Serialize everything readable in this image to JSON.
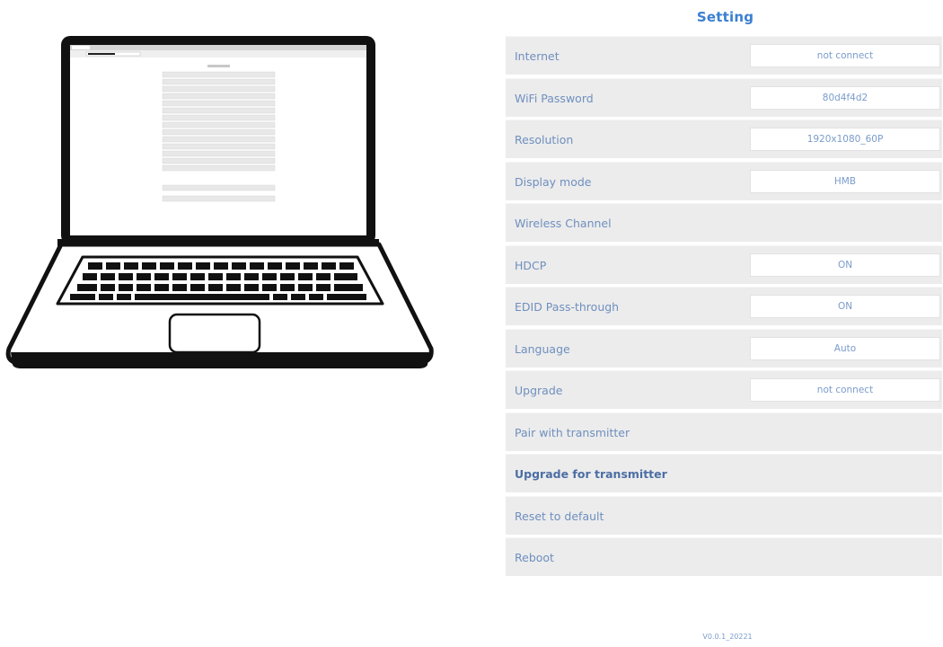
{
  "settings": {
    "title": "Setting",
    "rows": [
      {
        "label": "Internet",
        "value": "not connect"
      },
      {
        "label": "WiFi Password",
        "value": "80d4f4d2"
      },
      {
        "label": "Resolution",
        "value": "1920x1080_60P"
      },
      {
        "label": "Display mode",
        "value": "HMB"
      },
      {
        "label": "Wireless Channel",
        "value": null
      },
      {
        "label": "HDCP",
        "value": "ON"
      },
      {
        "label": "EDID Pass-through",
        "value": "ON"
      },
      {
        "label": "Language",
        "value": "Auto"
      },
      {
        "label": "Upgrade",
        "value": "not connect"
      },
      {
        "label": "Pair with transmitter",
        "value": null
      },
      {
        "label": "Upgrade for transmitter",
        "value": null
      },
      {
        "label": "Reset to default",
        "value": null
      },
      {
        "label": "Reboot",
        "value": null
      }
    ]
  },
  "footer": {
    "version": "V0.0.1_20221"
  },
  "icons": {
    "laptop": "laptop-icon"
  },
  "colors": {
    "accent": "#3a7fd1",
    "row_bg": "#ececec",
    "value_bg": "#ffffff",
    "text": "#6f8fbf"
  }
}
